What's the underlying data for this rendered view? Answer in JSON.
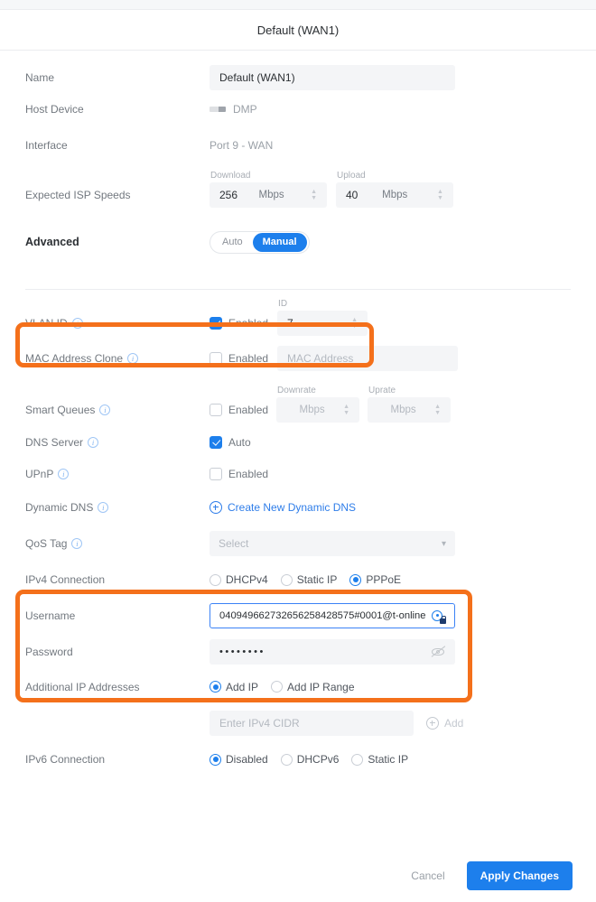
{
  "header": {
    "title": "Default (WAN1)"
  },
  "form": {
    "name": {
      "label": "Name",
      "value": "Default (WAN1)"
    },
    "host_device": {
      "label": "Host Device",
      "value": "DMP",
      "icon": "device-icon"
    },
    "interface": {
      "label": "Interface",
      "value": "Port 9 - WAN"
    },
    "isp_speeds": {
      "label": "Expected ISP Speeds",
      "download": {
        "label": "Download",
        "value": "256",
        "unit": "Mbps"
      },
      "upload": {
        "label": "Upload",
        "value": "40",
        "unit": "Mbps"
      }
    },
    "advanced": {
      "label": "Advanced",
      "options": [
        "Auto",
        "Manual"
      ],
      "selected": "Manual"
    },
    "vlan_id": {
      "label": "VLAN ID",
      "checkbox_label": "Enabled",
      "checked": true,
      "id_label": "ID",
      "id_value": "7",
      "highlighted": true
    },
    "mac_clone": {
      "label": "MAC Address Clone",
      "checkbox_label": "Enabled",
      "checked": false,
      "placeholder": "MAC Address"
    },
    "smart_queues": {
      "label": "Smart Queues",
      "checkbox_label": "Enabled",
      "checked": false,
      "downrate": {
        "label": "Downrate",
        "placeholder": "Mbps"
      },
      "uprate": {
        "label": "Uprate",
        "placeholder": "Mbps"
      }
    },
    "dns_server": {
      "label": "DNS Server",
      "checkbox_label": "Auto",
      "checked": true
    },
    "upnp": {
      "label": "UPnP",
      "checkbox_label": "Enabled",
      "checked": false
    },
    "dynamic_dns": {
      "label": "Dynamic DNS",
      "link": "Create New Dynamic DNS"
    },
    "qos_tag": {
      "label": "QoS Tag",
      "placeholder": "Select"
    },
    "ipv4_connection": {
      "label": "IPv4 Connection",
      "options": [
        "DHCPv4",
        "Static IP",
        "PPPoE"
      ],
      "selected": "PPPoE",
      "highlighted": true
    },
    "username": {
      "label": "Username",
      "value": "040949662732656258428575#0001@t-online",
      "icon": "key-lock-icon",
      "focused": true
    },
    "password": {
      "label": "Password",
      "value": "••••••••",
      "icon": "eye-off-icon"
    },
    "additional_ip": {
      "label": "Additional IP Addresses",
      "options": [
        "Add IP",
        "Add IP Range"
      ],
      "selected": "Add IP",
      "placeholder": "Enter IPv4 CIDR",
      "add_label": "Add"
    },
    "ipv6_connection": {
      "label": "IPv6 Connection",
      "options": [
        "Disabled",
        "DHCPv6",
        "Static IP"
      ],
      "selected": "Disabled"
    }
  },
  "footer": {
    "cancel": "Cancel",
    "apply": "Apply Changes"
  },
  "colors": {
    "accent": "#1d7fec",
    "highlight": "#f4701b",
    "link": "#2e7de9"
  }
}
